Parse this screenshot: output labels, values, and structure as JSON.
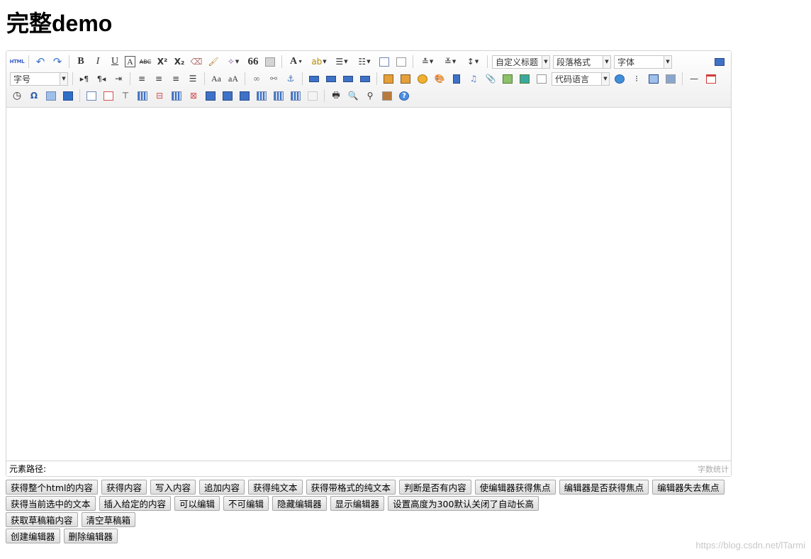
{
  "page": {
    "title": "完整demo"
  },
  "toolbar": {
    "html_label": "HTML",
    "bold": "B",
    "italic": "I",
    "underline": "U",
    "fontborder": "A",
    "strike": "ABC",
    "superscript": "X²",
    "subscript": "X₂",
    "blockquote": "66",
    "fontcolor": "A",
    "customstyle": "自定义标题",
    "paragraph": "段落格式",
    "fontfamily": "字体",
    "fontsize": "字号",
    "insertcode": "代码语言"
  },
  "editor": {
    "element_path_label": "元素路径:",
    "word_count_label": "字数统计"
  },
  "buttons": {
    "row1": [
      "获得整个html的内容",
      "获得内容",
      "写入内容",
      "追加内容",
      "获得纯文本",
      "获得带格式的纯文本",
      "判断是否有内容",
      "使编辑器获得焦点",
      "编辑器是否获得焦点",
      "编辑器失去焦点"
    ],
    "row2": [
      "获得当前选中的文本",
      "插入给定的内容",
      "可以编辑",
      "不可编辑",
      "隐藏编辑器",
      "显示编辑器",
      "设置高度为300默认关闭了自动长高"
    ],
    "row3": [
      "获取草稿箱内容",
      "清空草稿箱"
    ],
    "row4": [
      "创建编辑器",
      "删除编辑器"
    ]
  },
  "watermark": "https://blog.csdn.net/lTarmi"
}
